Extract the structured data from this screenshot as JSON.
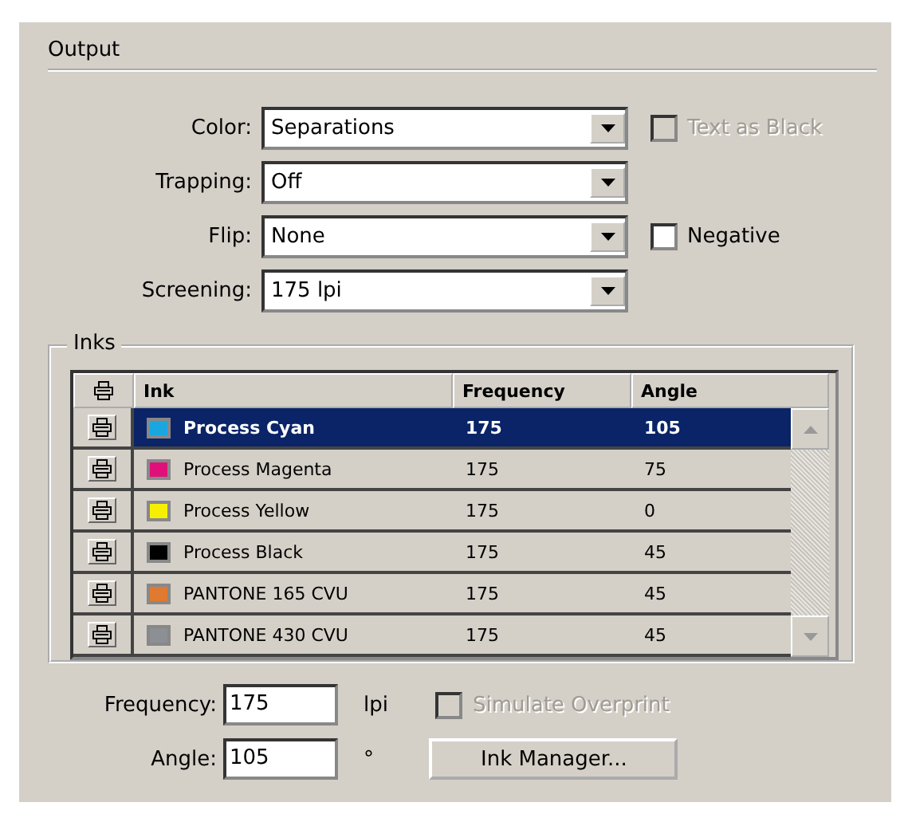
{
  "section": {
    "title": "Output"
  },
  "fields": [
    {
      "label": "Color:",
      "value": "Separations",
      "option": {
        "label": "Text as Black",
        "checked": false,
        "disabled": true
      }
    },
    {
      "label": "Trapping:",
      "value": "Off"
    },
    {
      "label": "Flip:",
      "value": "None",
      "option": {
        "label": "Negative",
        "checked": false,
        "disabled": false
      }
    },
    {
      "label": "Screening:",
      "value": "175 lpi"
    }
  ],
  "inks": {
    "title": "Inks",
    "columns": [
      "Ink",
      "Frequency",
      "Angle"
    ],
    "rows": [
      {
        "name": "Process Cyan",
        "frequency": "175",
        "angle": "105",
        "color": "#1aa7e0",
        "selected": true
      },
      {
        "name": "Process Magenta",
        "frequency": "175",
        "angle": "75",
        "color": "#e0107a",
        "selected": false
      },
      {
        "name": "Process Yellow",
        "frequency": "175",
        "angle": "0",
        "color": "#f6f000",
        "selected": false
      },
      {
        "name": "Process Black",
        "frequency": "175",
        "angle": "45",
        "color": "#000000",
        "selected": false
      },
      {
        "name": "PANTONE 165 CVU",
        "frequency": "175",
        "angle": "45",
        "color": "#e07a30",
        "selected": false
      },
      {
        "name": "PANTONE 430 CVU",
        "frequency": "175",
        "angle": "45",
        "color": "#8c9094",
        "selected": false
      }
    ],
    "frequency": {
      "label": "Frequency:",
      "value": "175",
      "unit": "lpi"
    },
    "angle": {
      "label": "Angle:",
      "value": "105",
      "unit": "°"
    },
    "simulate_overprint": {
      "label": "Simulate Overprint",
      "checked": false,
      "disabled": true
    },
    "button": "Ink Manager..."
  }
}
